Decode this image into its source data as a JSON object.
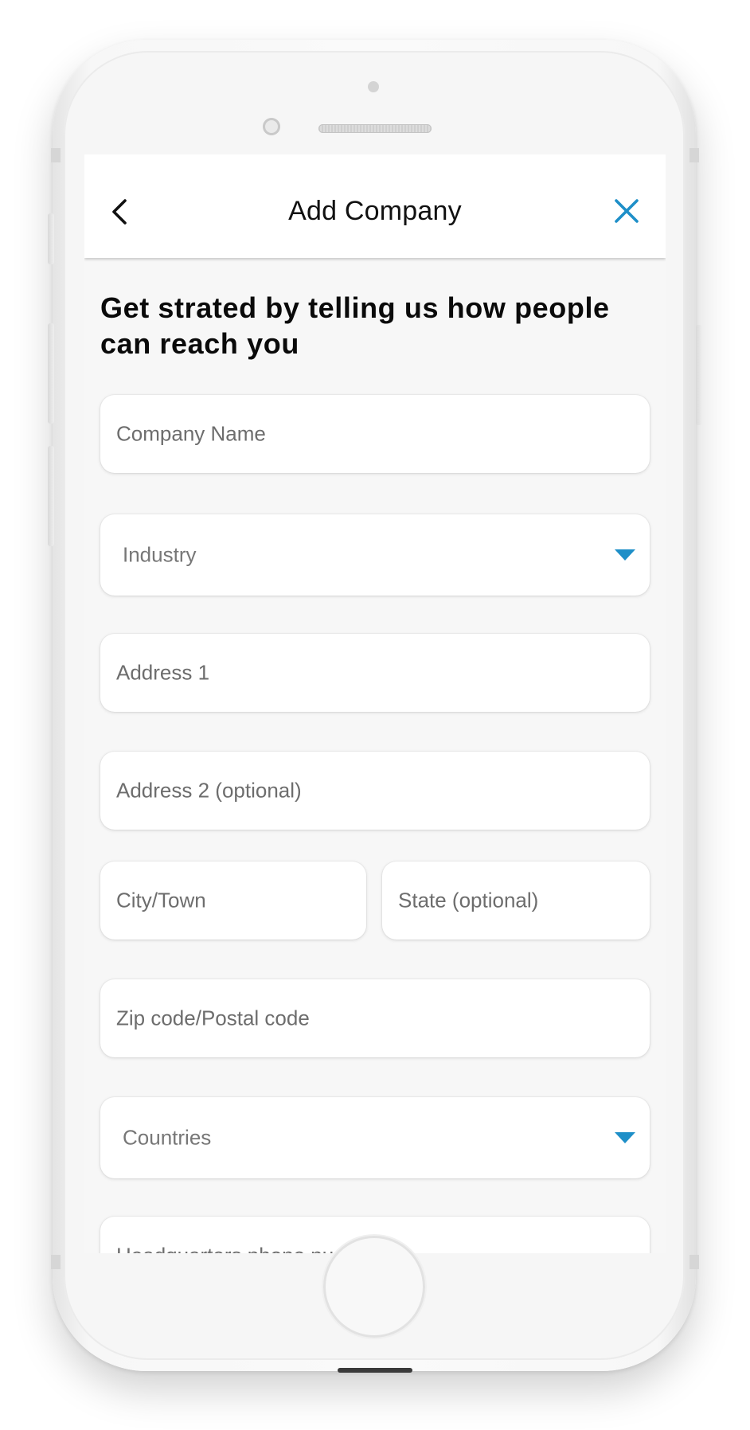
{
  "header": {
    "title": "Add Company",
    "back_icon": "chevron-left-icon",
    "close_icon": "close-icon"
  },
  "colors": {
    "accent": "#1e8fc8",
    "screen_background": "#f7f7f7",
    "field_background": "#ffffff",
    "placeholder_text": "#6d6d6d"
  },
  "form": {
    "heading": "Get strated by telling us how people can reach you",
    "company_name": {
      "placeholder": "Company Name",
      "value": ""
    },
    "industry": {
      "placeholder": "Industry",
      "icon": "caret-down-icon"
    },
    "address1": {
      "placeholder": "Address 1",
      "value": ""
    },
    "address2": {
      "placeholder": "Address 2 (optional)",
      "value": ""
    },
    "city": {
      "placeholder": "City/Town",
      "value": ""
    },
    "state": {
      "placeholder": "State (optional)",
      "value": ""
    },
    "zip": {
      "placeholder": "Zip code/Postal code",
      "value": ""
    },
    "country": {
      "placeholder": "Countries",
      "icon": "caret-down-icon"
    },
    "hq_phone": {
      "placeholder": "Headquarters phone number",
      "value": ""
    }
  }
}
